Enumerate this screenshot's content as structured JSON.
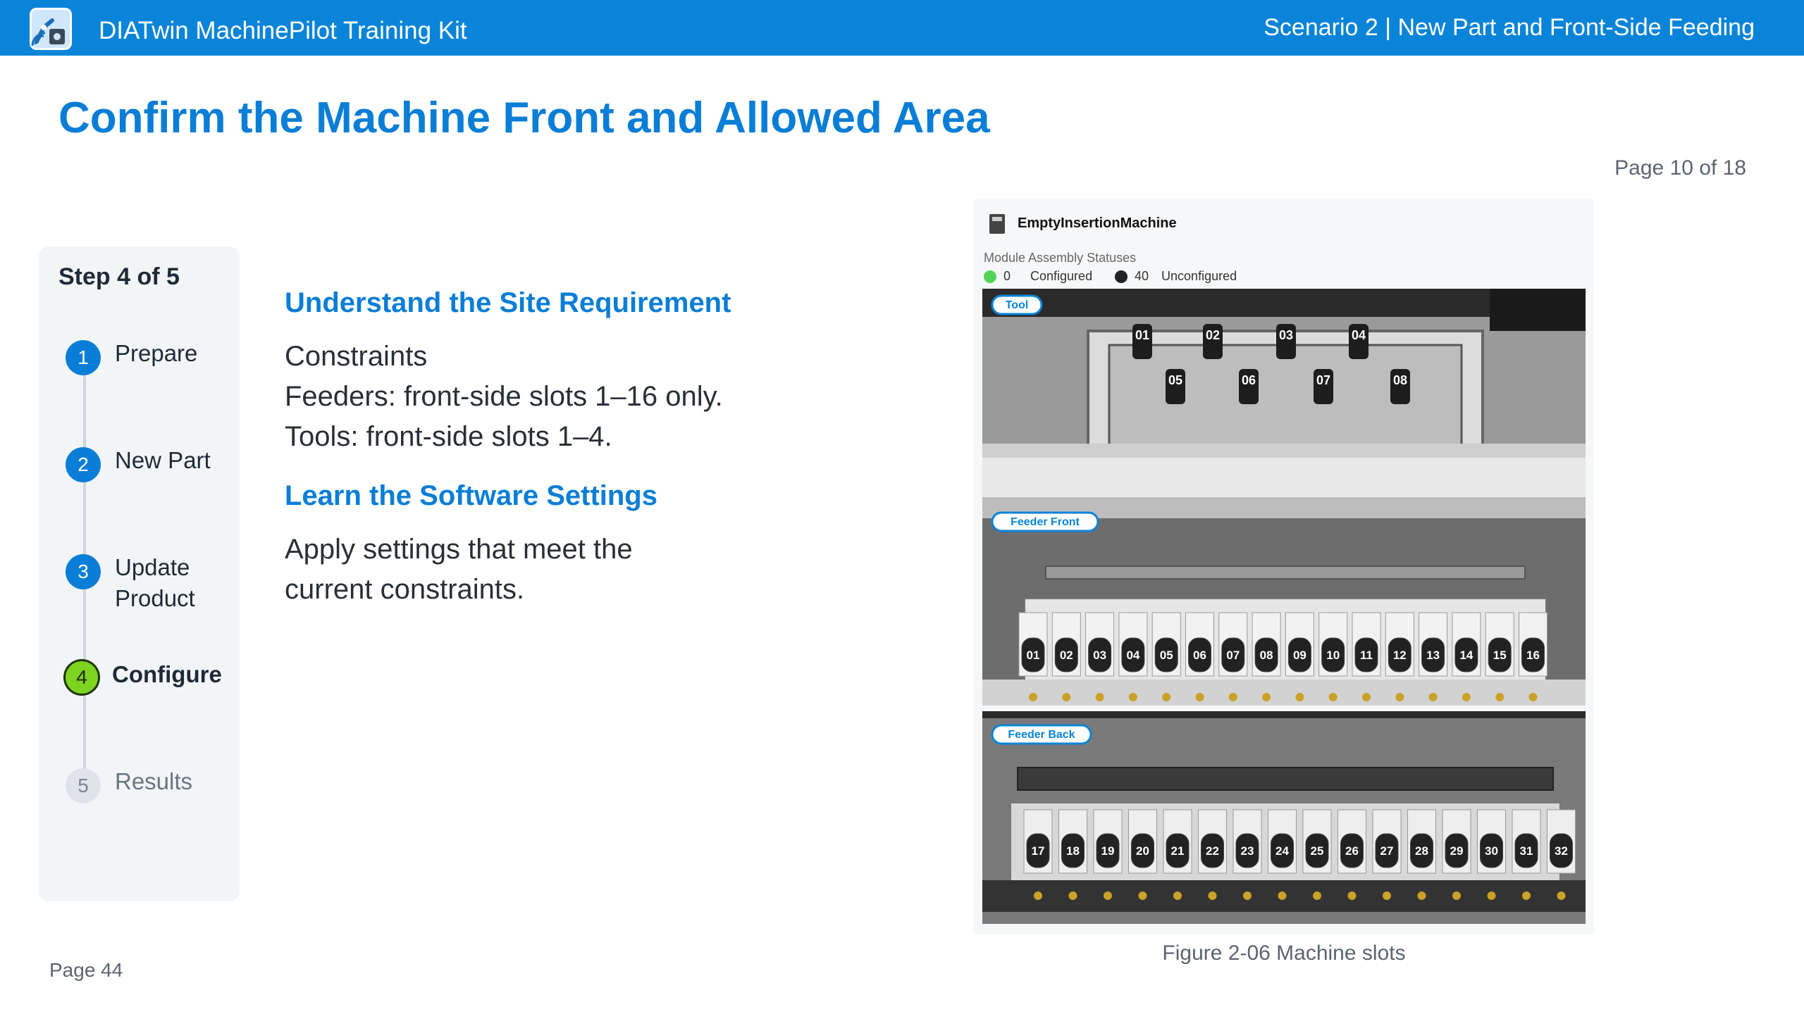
{
  "header": {
    "app_title": "DIATwin MachinePilot Training Kit",
    "scenario": "Scenario 2 | New Part and Front-Side Feeding",
    "logo_icon": "robot-arm-icon"
  },
  "page": {
    "title": "Confirm the Machine Front and Allowed Area",
    "indicator": "Page 10 of 18",
    "footer": "Page 44"
  },
  "steps": {
    "counter": "Step 4 of 5",
    "items": [
      {
        "num": "1",
        "label": "Prepare",
        "state": "done"
      },
      {
        "num": "2",
        "label": "New Part",
        "state": "done"
      },
      {
        "num": "3",
        "label": "Update Product",
        "state": "done"
      },
      {
        "num": "4",
        "label": "Configure",
        "state": "active"
      },
      {
        "num": "5",
        "label": "Results",
        "state": "pending"
      }
    ]
  },
  "content": {
    "section1_heading": "Understand the Site Requirement",
    "constraints_heading": "Constraints",
    "constraint_feeders": "Feeders: front-side slots 1–16 only.",
    "constraint_tools": "Tools: front-side slots 1–4.",
    "section2_heading": "Learn the Software Settings",
    "settings_line1": "Apply settings that meet the",
    "settings_line2": "current constraints."
  },
  "figure": {
    "machine_name": "EmptyInsertionMachine",
    "status_title": "Module Assembly Statuses",
    "configured_count": "0",
    "configured_label": "Configured",
    "unconfigured_count": "40",
    "unconfigured_label": "Unconfigured",
    "configured_color": "#57d35a",
    "unconfigured_color": "#222222",
    "zone_tool": "Tool",
    "zone_feeder_front": "Feeder Front",
    "zone_feeder_back": "Feeder Back",
    "tool_slots": [
      "01",
      "02",
      "03",
      "04",
      "05",
      "06",
      "07",
      "08"
    ],
    "front_slots": [
      "01",
      "02",
      "03",
      "04",
      "05",
      "06",
      "07",
      "08",
      "09",
      "10",
      "11",
      "12",
      "13",
      "14",
      "15",
      "16"
    ],
    "back_slots": [
      "17",
      "18",
      "19",
      "20",
      "21",
      "22",
      "23",
      "24",
      "25",
      "26",
      "27",
      "28",
      "29",
      "30",
      "31",
      "32"
    ],
    "caption": "Figure 2-06 Machine slots"
  }
}
